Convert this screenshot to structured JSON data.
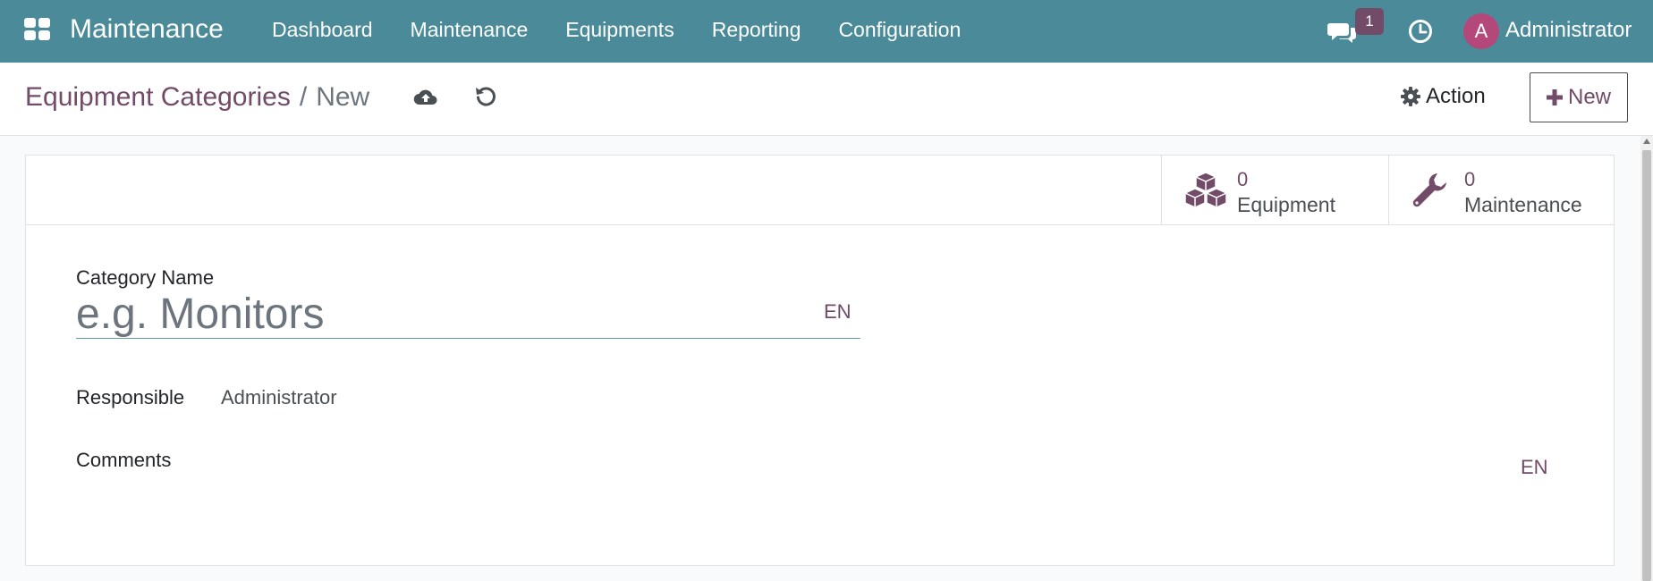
{
  "navbar": {
    "brand": "Maintenance",
    "menu": [
      "Dashboard",
      "Maintenance",
      "Equipments",
      "Reporting",
      "Configuration"
    ],
    "chat_badge": "1",
    "avatar_initial": "A",
    "user_name": "Administrator"
  },
  "control_panel": {
    "breadcrumb_parent": "Equipment Categories",
    "breadcrumb_separator": "/",
    "breadcrumb_current": "New",
    "action_label": "Action",
    "new_label": "New"
  },
  "stat_buttons": [
    {
      "value": "0",
      "label": "Equipment",
      "icon": "cubes-icon"
    },
    {
      "value": "0",
      "label": "Maintenance",
      "icon": "wrench-icon"
    }
  ],
  "form": {
    "category_name_label": "Category Name",
    "category_name_value": "",
    "category_name_placeholder": "e.g. Monitors",
    "lang_name": "EN",
    "responsible_label": "Responsible",
    "responsible_value": "Administrator",
    "comments_label": "Comments",
    "lang_comments": "EN"
  },
  "colors": {
    "navbar": "#4b8b99",
    "accent": "#714b67",
    "avatar": "#b4487b"
  }
}
